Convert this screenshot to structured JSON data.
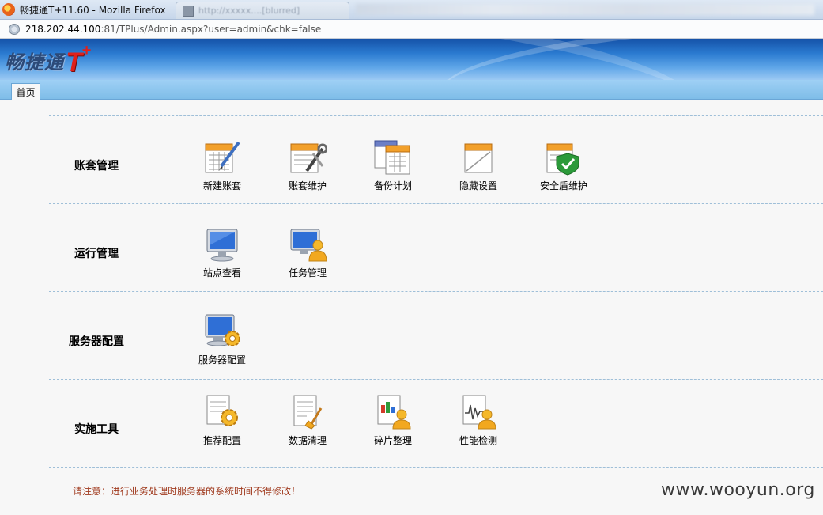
{
  "browser": {
    "window_title": "畅捷通T+11.60 - Mozilla Firefox",
    "second_tab_title": "http://xxxxx....[blurred]",
    "url_host": "218.202.44.100",
    "url_rest": ":81/TPlus/Admin.aspx?user=admin&chk=false"
  },
  "banner": {
    "logo_text": "畅捷通",
    "logo_t": "T",
    "logo_plus": "+"
  },
  "tabs": [
    {
      "label": "首页"
    }
  ],
  "sections": [
    {
      "title": "账套管理",
      "items": [
        {
          "label": "新建账套",
          "icon": "calendar-pen-icon"
        },
        {
          "label": "账套维护",
          "icon": "calendar-wrench-icon"
        },
        {
          "label": "备份计划",
          "icon": "calendar-stack-icon"
        },
        {
          "label": "隐藏设置",
          "icon": "calendar-hide-icon"
        },
        {
          "label": "安全盾维护",
          "icon": "calendar-shield-icon"
        }
      ]
    },
    {
      "title": "运行管理",
      "items": [
        {
          "label": "站点查看",
          "icon": "monitor-icon"
        },
        {
          "label": "任务管理",
          "icon": "monitor-user-icon"
        }
      ]
    },
    {
      "title": "服务器配置",
      "items": [
        {
          "label": "服务器配置",
          "icon": "monitor-gear-icon"
        }
      ]
    },
    {
      "title": "实施工具",
      "items": [
        {
          "label": "推荐配置",
          "icon": "document-gear-icon"
        },
        {
          "label": "数据清理",
          "icon": "document-broom-icon"
        },
        {
          "label": "碎片整理",
          "icon": "chart-user-icon"
        },
        {
          "label": "性能检测",
          "icon": "waveform-user-icon"
        }
      ]
    }
  ],
  "notice": "请注意：进行业务处理时服务器的系统时间不得修改！",
  "watermark": "www.wooyun.org",
  "colors": {
    "banner_dark": "#1552a8",
    "banner_light": "#9cc9f3",
    "tabstrip": "#8cc6ee",
    "notice_text": "#a03a1e",
    "logo_red": "#e0201b"
  }
}
